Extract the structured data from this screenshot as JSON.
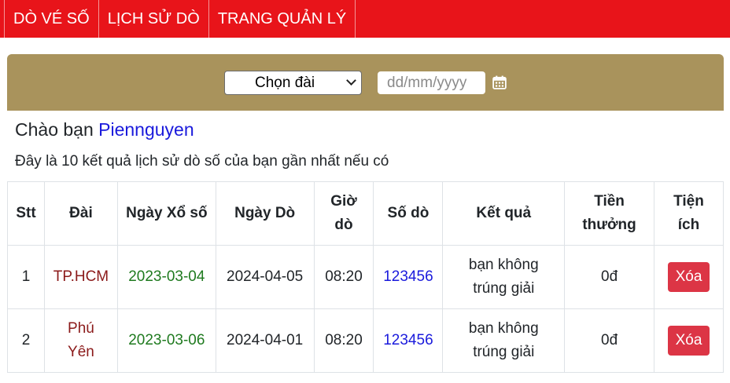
{
  "nav": {
    "items": [
      "DÒ VÉ SỐ",
      "LỊCH SỬ DÒ",
      "TRANG QUẢN LÝ"
    ]
  },
  "filter": {
    "select_value": "Chọn đài",
    "date_placeholder": "dd/mm/yyyy",
    "calendar_icon": "calendar-icon"
  },
  "greeting": {
    "prefix": "Chào bạn ",
    "username": "Piennguyen",
    "subtitle": "Đây là 10 kết quả lịch sử dò số của bạn gần nhất nếu có"
  },
  "table": {
    "headers": {
      "stt": "Stt",
      "dai": "Đài",
      "ngay_xo_so": "Ngày Xổ số",
      "ngay_do": "Ngày Dò",
      "gio_do_1": "Giờ",
      "gio_do_2": "dò",
      "so_do": "Số dò",
      "ket_qua": "Kết quả",
      "tien_thuong_1": "Tiền",
      "tien_thuong_2": "thưởng",
      "tien_ich_1": "Tiện",
      "tien_ich_2": "ích"
    },
    "rows": [
      {
        "stt": "1",
        "dai_1": "TP.HCM",
        "dai_2": "",
        "ngay_xo_so": "2023-03-04",
        "ngay_do": "2024-04-05",
        "gio_do": "08:20",
        "so_do": "123456",
        "ket_qua_1": "bạn không",
        "ket_qua_2": "trúng giải",
        "tien_thuong": "0đ",
        "action": "Xóa"
      },
      {
        "stt": "2",
        "dai_1": "Phú",
        "dai_2": "Yên",
        "ngay_xo_so": "2023-03-06",
        "ngay_do": "2024-04-01",
        "gio_do": "08:20",
        "so_do": "123456",
        "ket_qua_1": "bạn không",
        "ket_qua_2": "trúng giải",
        "tien_thuong": "0đ",
        "action": "Xóa"
      }
    ]
  },
  "colors": {
    "nav_bg": "#e8141a",
    "filter_bg": "#a9935c",
    "delete_btn": "#dc3545",
    "username": "#1a1adc",
    "station": "#8b1a1a",
    "draw_date": "#1f7a1f"
  }
}
